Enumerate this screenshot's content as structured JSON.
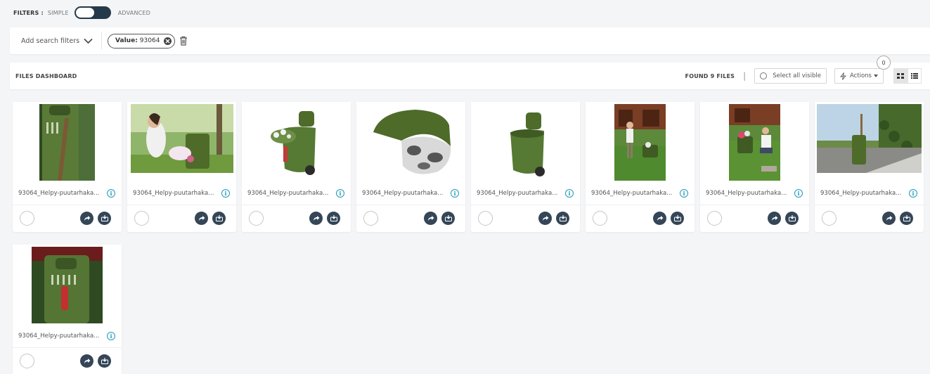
{
  "filter_mode": {
    "label": "FILTERS :",
    "simple": "SIMPLE",
    "advanced": "ADVANCED"
  },
  "filters": {
    "add_label": "Add search filters",
    "chip_key": "Value:",
    "chip_value": "93064"
  },
  "dashboard": {
    "title": "FILES DASHBOARD",
    "found": "FOUND 9 FILES",
    "separator": "|",
    "select_all": "Select all visible",
    "actions": "Actions",
    "actions_count": "0"
  },
  "colors": {
    "accent_dark": "#243a4a",
    "info_blue": "#1e9ab7",
    "product_green": "#4e6b2a"
  },
  "files": [
    {
      "name": "93064_Helpy-puutarhaka...",
      "image": "cart-closeup-photo"
    },
    {
      "name": "93064_Helpy-puutarhaka...",
      "image": "woman-with-cart-photo"
    },
    {
      "name": "93064_Helpy-puutarhaka...",
      "image": "cart-with-flowers-photo"
    },
    {
      "name": "93064_Helpy-puutarhaka...",
      "image": "cart-top-view-photo"
    },
    {
      "name": "93064_Helpy-puutarhaka...",
      "image": "cart-product-photo"
    },
    {
      "name": "93064_Helpy-puutarhaka...",
      "image": "man-pulling-cart-photo"
    },
    {
      "name": "93064_Helpy-puutarhaka...",
      "image": "woman-gardening-photo"
    },
    {
      "name": "93064_Helpy-puutarhaka...",
      "image": "cart-in-garden-photo"
    },
    {
      "name": "93064_Helpy-puutarhaka...",
      "image": "cart-with-shears-photo"
    }
  ]
}
